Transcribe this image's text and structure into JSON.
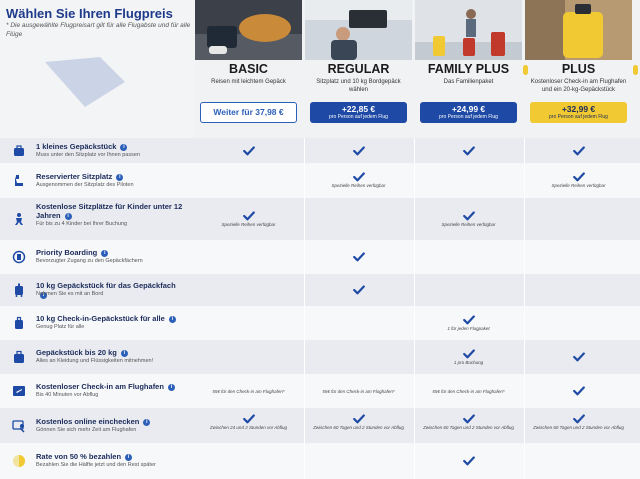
{
  "title": "Wählen Sie Ihren Flugpreis",
  "subtitle": "* Die ausgewählte Flugpreisart gilt für alle Flugabste und für alle Flüge",
  "colors": {
    "navy": "#1e4aa5",
    "yellow": "#f1c933",
    "text": "#1b2b5a"
  },
  "fares": [
    {
      "name": "BASIC",
      "desc": "Reisen mit leichtem Gepäck",
      "price": "Weiter für 37,98 €",
      "price_sub": "",
      "style": "outline",
      "accent": false
    },
    {
      "name": "REGULAR",
      "desc": "Sitzplatz und 10 kg Bordgepäck wählen",
      "price": "+22,85 €",
      "price_sub": "pro Person auf jedem Flug",
      "style": "blue",
      "accent": false
    },
    {
      "name": "FAMILY PLUS",
      "desc": "Das Familienpaket",
      "price": "+24,99 €",
      "price_sub": "pro Person auf jedem Flug",
      "style": "blue",
      "accent": true
    },
    {
      "name": "PLUS",
      "desc": "Kostenloser Check-in am Flughafen und ein 20-kg-Gepäckstück",
      "price": "+32,99 €",
      "price_sub": "pro Person auf jedem Flug",
      "style": "yellow",
      "accent": true
    }
  ],
  "rows": [
    {
      "title": "1 kleines Gepäckstück",
      "sub": "Muss unter den Sitzplatz vor Ihnen passen",
      "icon": "bag-icon",
      "cells": [
        {
          "check": true,
          "note": ""
        },
        {
          "check": true,
          "note": ""
        },
        {
          "check": true,
          "note": ""
        },
        {
          "check": true,
          "note": ""
        }
      ]
    },
    {
      "title": "Reservierter Sitzplatz",
      "sub": "Ausgenommen der Sitzplatz des Piloten",
      "icon": "seat-icon",
      "cells": [
        {
          "check": false,
          "note": ""
        },
        {
          "check": true,
          "note": "Spezielle Reihen verfügbar"
        },
        {
          "check": false,
          "note": ""
        },
        {
          "check": true,
          "note": "Spezielle Reihen verfügbar"
        }
      ]
    },
    {
      "title": "Kostenlose Sitzplätze für Kinder unter 12 Jahren",
      "sub": "Für bis zu 4 Kinder bei Ihrer Buchung",
      "icon": "child-icon",
      "cells": [
        {
          "check": true,
          "note": "Spezielle Reihen verfügbar"
        },
        {
          "check": false,
          "note": ""
        },
        {
          "check": true,
          "note": "Spezielle Reihen verfügbar"
        },
        {
          "check": false,
          "note": ""
        }
      ]
    },
    {
      "title": "Priority Boarding",
      "sub": "Bevorzugter Zugang zu den Gepäckfächern",
      "icon": "priority-icon",
      "cells": [
        {
          "check": false,
          "note": ""
        },
        {
          "check": true,
          "note": ""
        },
        {
          "check": false,
          "note": ""
        },
        {
          "check": false,
          "note": ""
        }
      ]
    },
    {
      "title": "10 kg Gepäckstück für das Gepäckfach",
      "sub": "Nehmen Sie es mit an Bord",
      "icon": "trolley-icon",
      "cells": [
        {
          "check": false,
          "note": ""
        },
        {
          "check": true,
          "note": ""
        },
        {
          "check": false,
          "note": ""
        },
        {
          "check": false,
          "note": ""
        }
      ]
    },
    {
      "title": "10 kg Check-in-Gepäckstück für alle",
      "sub": "Genug Platz für alle",
      "icon": "checkin-bag-icon",
      "cells": [
        {
          "check": false,
          "note": ""
        },
        {
          "check": false,
          "note": ""
        },
        {
          "check": true,
          "note": "1 für jeden Flugpaket"
        },
        {
          "check": false,
          "note": ""
        }
      ]
    },
    {
      "title": "Gepäckstück bis 20 kg",
      "sub": "Alles an Kleidung und Flüssigkeiten mitnehmen!",
      "icon": "suitcase-icon",
      "cells": [
        {
          "check": false,
          "note": ""
        },
        {
          "check": false,
          "note": ""
        },
        {
          "check": true,
          "note": "1 pro Buchung"
        },
        {
          "check": true,
          "note": ""
        }
      ]
    },
    {
      "title": "Kostenloser Check-in am Flughafen",
      "sub": "Bis 40 Minuten vor Abflug",
      "icon": "airport-checkin-icon",
      "cells": [
        {
          "check": false,
          "note": "55€ für den Check-in am Flughafen*"
        },
        {
          "check": false,
          "note": "55€ für den Check-in am Flughafen*"
        },
        {
          "check": false,
          "note": "55€ für den Check-in am Flughafen*"
        },
        {
          "check": true,
          "note": ""
        }
      ]
    },
    {
      "title": "Kostenlos online einchecken",
      "sub": "Gönnen Sie sich mehr Zeit am Flughafen",
      "icon": "online-checkin-icon",
      "cells": [
        {
          "check": true,
          "note": "Zwischen 24 und 2 Stunden vor Abflug"
        },
        {
          "check": true,
          "note": "Zwischen 60 Tagen und 2 Stunden vor Abflug"
        },
        {
          "check": true,
          "note": "Zwischen 60 Tagen und 2 Stunden vor Abflug"
        },
        {
          "check": true,
          "note": "Zwischen 60 Tagen und 2 Stunden vor Abflug"
        }
      ]
    },
    {
      "title": "Rate von 50 % bezahlen",
      "sub": "Bezahlen Sie die Hälfte jetzt und den Rest später",
      "icon": "half-payment-icon",
      "cells": [
        {
          "check": false,
          "note": ""
        },
        {
          "check": false,
          "note": ""
        },
        {
          "check": true,
          "note": ""
        },
        {
          "check": false,
          "note": ""
        }
      ]
    }
  ]
}
